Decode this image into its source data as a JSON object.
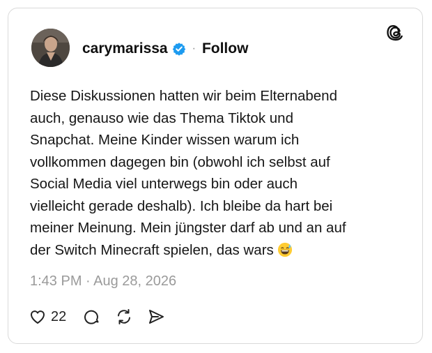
{
  "post": {
    "username": "carymarissa",
    "follow_label": "Follow",
    "separator": "·",
    "text": "Diese Diskussionen hatten wir beim Elternabend\nauch, genauso wie das Thema Tiktok und\nSnapchat. Meine Kinder wissen warum ich\nvollkommen dagegen bin (obwohl ich selbst auf\nSocial Media viel unterwegs bin oder auch\nvielleicht gerade deshalb). Ich bleibe da hart bei\nmeiner Meinung. Mein jüngster darf ab und an auf\nder Switch Minecraft spielen, das wars ",
    "emoji": "grinning-face-with-sweat",
    "timestamp": "1:43 PM · Aug 28, 2026",
    "like_count": "22"
  },
  "icons": {
    "brand": "threads-logo",
    "verified": "verified-badge-icon",
    "like": "heart-icon",
    "reply": "comment-icon",
    "repost": "repost-icon",
    "share": "share-icon"
  },
  "colors": {
    "verified_blue": "#1d9bf0",
    "muted_text": "#9a9a9a",
    "border": "#d9d9d9"
  }
}
